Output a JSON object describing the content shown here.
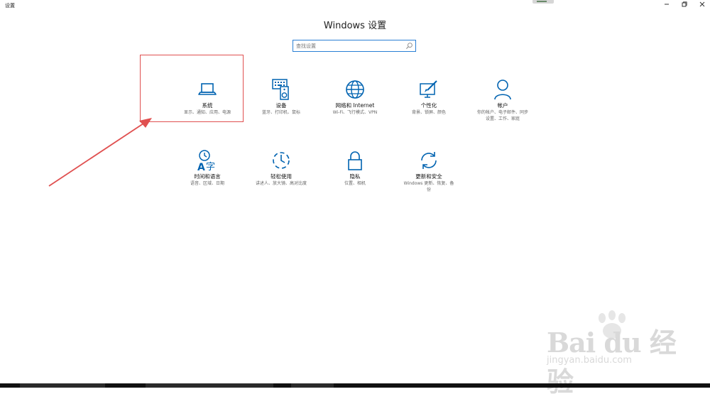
{
  "window": {
    "app_title": "设置",
    "minimize_icon": "minimize-icon",
    "maximize_icon": "restore-icon",
    "close_icon": "close-icon"
  },
  "header": {
    "title": "Windows 设置"
  },
  "search": {
    "placeholder": "查找设置",
    "value": "",
    "icon": "search-icon"
  },
  "accent_color": "#0063b1",
  "annotation_color": "#e05050",
  "tiles": [
    {
      "icon": "laptop-icon",
      "title": "系统",
      "desc_lines": [
        "显示、通知、应用、电源"
      ]
    },
    {
      "icon": "keyboard-speaker-icon",
      "title": "设备",
      "desc_lines": [
        "蓝牙、打印机、鼠标"
      ]
    },
    {
      "icon": "globe-icon",
      "title": "网络和 Internet",
      "desc_lines": [
        "Wi-Fi、飞行模式、VPN"
      ]
    },
    {
      "icon": "paint-brush-icon",
      "title": "个性化",
      "desc_lines": [
        "背景、锁屏、颜色"
      ]
    },
    {
      "icon": "person-icon",
      "title": "帐户",
      "desc_lines": [
        "你的帐户、电子邮件、同步",
        "设置、工作、家庭"
      ]
    },
    {
      "icon": "time-language-icon",
      "title": "时间和语言",
      "desc_lines": [
        "语音、区域、日期"
      ]
    },
    {
      "icon": "ease-of-access-icon",
      "title": "轻松使用",
      "desc_lines": [
        "讲述人、放大镜、高对比度"
      ]
    },
    {
      "icon": "lock-icon",
      "title": "隐私",
      "desc_lines": [
        "位置、相机"
      ]
    },
    {
      "icon": "sync-icon",
      "title": "更新和安全",
      "desc_lines": [
        "Windows 更新、恢复、备",
        "份"
      ]
    }
  ],
  "watermark": {
    "main": "Bai du 经验",
    "sub": "jingyan.baidu.com"
  }
}
